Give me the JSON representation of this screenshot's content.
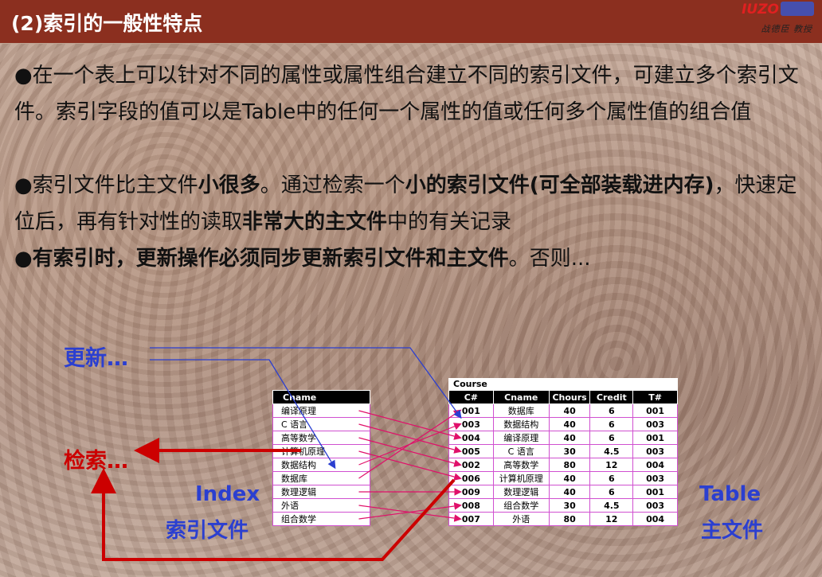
{
  "header": {
    "title": "(2)索引的一般性特点",
    "logo_mark": "IUZO",
    "logo_text": "战德臣 教授"
  },
  "content": {
    "p1": "●在一个表上可以针对不同的属性或属性组合建立不同的索引文件，可建立多个索引文件。索引字段的值可以是Table中的任何一个属性的值或任何多个属性值的组合值",
    "p2": {
      "a": "●索引文件比主文件",
      "b": "小很多",
      "c": "。通过检索一个",
      "d": "小的索引文件(可全部装载进内存)",
      "e": "，快速定位后，再有针对性的读取",
      "f": "非常大的主文件",
      "g": "中的有关记录"
    },
    "p3": {
      "a": "●有索引时，更新操作必须同步更新索引文件和主文件",
      "b": "。否则..."
    }
  },
  "diagram": {
    "update_label": "更新…",
    "search_label": "检索…",
    "index_label_en": "Index",
    "index_label_cn": "索引文件",
    "table_label_en": "Table",
    "table_label_cn": "主文件",
    "index_header": "Cname",
    "index_rows": [
      "编译原理",
      "C 语言",
      "高等数学",
      "计算机原理",
      "数据结构",
      "数据库",
      "数理逻辑",
      "外语",
      "组合数学"
    ],
    "course_caption": "Course",
    "course_headers": [
      "C#",
      "Cname",
      "Chours",
      "Credit",
      "T#"
    ],
    "course_rows": [
      [
        "001",
        "数据库",
        "40",
        "6",
        "001"
      ],
      [
        "003",
        "数据结构",
        "40",
        "6",
        "003"
      ],
      [
        "004",
        "编译原理",
        "40",
        "6",
        "001"
      ],
      [
        "005",
        "C 语言",
        "30",
        "4.5",
        "003"
      ],
      [
        "002",
        "高等数学",
        "80",
        "12",
        "004"
      ],
      [
        "006",
        "计算机原理",
        "40",
        "6",
        "003"
      ],
      [
        "009",
        "数理逻辑",
        "40",
        "6",
        "001"
      ],
      [
        "008",
        "组合数学",
        "30",
        "4.5",
        "003"
      ],
      [
        "007",
        "外语",
        "80",
        "12",
        "004"
      ]
    ],
    "colors": {
      "update": "#2b3fd0",
      "search": "#cc0000",
      "labels": "#2b3fd0",
      "pointer": "#e0106a"
    }
  }
}
